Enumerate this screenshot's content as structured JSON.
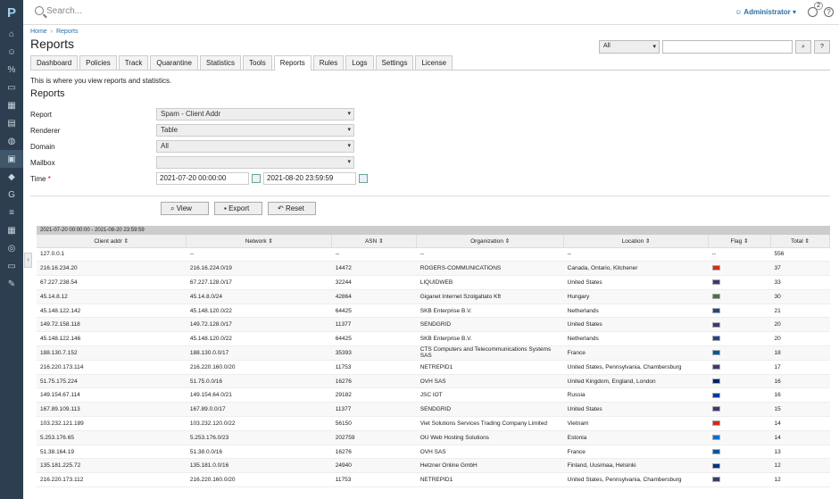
{
  "app": {
    "logo": "P",
    "search_placeholder": "Search...",
    "user": "Administrator",
    "notif_count": "2"
  },
  "breadcrumb": {
    "home": "Home",
    "sep": "›",
    "current": "Reports"
  },
  "page_title": "Reports",
  "filter": {
    "select": "All"
  },
  "tabs": [
    "Dashboard",
    "Policies",
    "Track",
    "Quarantine",
    "Statistics",
    "Tools",
    "Reports",
    "Rules",
    "Logs",
    "Settings",
    "License"
  ],
  "intro": "This is where you view reports and statistics.",
  "section": "Reports",
  "form": {
    "report_label": "Report",
    "report_value": "Spam - Client Addr",
    "renderer_label": "Renderer",
    "renderer_value": "Table",
    "domain_label": "Domain",
    "domain_value": "All",
    "mailbox_label": "Mailbox",
    "mailbox_value": "",
    "time_label": "Time",
    "required": "*",
    "time_from": "2021-07-20 00:00:00",
    "time_to": "2021-08-20 23:59:59"
  },
  "buttons": {
    "view": "View",
    "export": "Export",
    "reset": "Reset"
  },
  "period": "2021-07-20 00:00:00 - 2021-08-20 23:59:59",
  "table": {
    "headers": [
      "Client addr",
      "Network",
      "ASN",
      "Organization",
      "Location",
      "Flag",
      "Total"
    ],
    "rows": [
      [
        "127.0.0.1",
        "--",
        "--",
        "--",
        "--",
        "--",
        "556"
      ],
      [
        "216.16.234.20",
        "216.16.224.0/19",
        "14472",
        "ROGERS-COMMUNICATIONS",
        "Canada, Ontario, Kitchener",
        "CA",
        "37"
      ],
      [
        "67.227.238.54",
        "67.227.128.0/17",
        "32244",
        "LIQUIDWEB",
        "United States",
        "US",
        "33"
      ],
      [
        "45.14.8.12",
        "45.14.8.0/24",
        "42864",
        "Giganet Internet Szolgaltato Kft",
        "Hungary",
        "HU",
        "30"
      ],
      [
        "45.148.122.142",
        "45.148.120.0/22",
        "64425",
        "SKB Enterprise B.V.",
        "Netherlands",
        "NL",
        "21"
      ],
      [
        "149.72.158.118",
        "149.72.128.0/17",
        "11377",
        "SENDGRID",
        "United States",
        "US",
        "20"
      ],
      [
        "45.148.122.146",
        "45.148.120.0/22",
        "64425",
        "SKB Enterprise B.V.",
        "Netherlands",
        "NL",
        "20"
      ],
      [
        "188.130.7.152",
        "188.130.0.0/17",
        "35393",
        "CTS Computers and Telecommunications Systems SAS",
        "France",
        "FR",
        "18"
      ],
      [
        "216.220.173.114",
        "216.220.160.0/20",
        "11753",
        "NETREPID1",
        "United States, Pennsylvania, Chambersburg",
        "US",
        "17"
      ],
      [
        "51.75.175.224",
        "51.75.0.0/16",
        "16276",
        "OVH SAS",
        "United Kingdom, England, London",
        "GB",
        "16"
      ],
      [
        "149.154.67.114",
        "149.154.64.0/21",
        "29182",
        "JSC IOT",
        "Russia",
        "RU",
        "16"
      ],
      [
        "167.89.109.113",
        "167.89.0.0/17",
        "11377",
        "SENDGRID",
        "United States",
        "US",
        "15"
      ],
      [
        "103.232.121.189",
        "103.232.120.0/22",
        "56150",
        "Viet Solutions Services Trading Company Limited",
        "Vietnam",
        "VN",
        "14"
      ],
      [
        "5.253.176.65",
        "5.253.176.0/23",
        "202759",
        "OU Web Hosting Solutions",
        "Estonia",
        "EE",
        "14"
      ],
      [
        "51.38.164.19",
        "51.38.0.0/16",
        "16276",
        "OVH SAS",
        "France",
        "FR",
        "13"
      ],
      [
        "135.181.225.72",
        "135.181.0.0/16",
        "24940",
        "Hetzner Online GmbH",
        "Finland, Uusimaa, Helsinki",
        "FI",
        "12"
      ],
      [
        "216.220.173.112",
        "216.220.160.0/20",
        "11753",
        "NETREPID1",
        "United States, Pennsylvania, Chambersburg",
        "US",
        "12"
      ]
    ]
  },
  "flag_colors": {
    "CA": "#d52b1e",
    "US": "#3c3b6e",
    "HU": "#477050",
    "NL": "#21468b",
    "FR": "#0055a4",
    "GB": "#012169",
    "RU": "#0039a6",
    "VN": "#da251d",
    "EE": "#0072ce",
    "FI": "#003580"
  }
}
